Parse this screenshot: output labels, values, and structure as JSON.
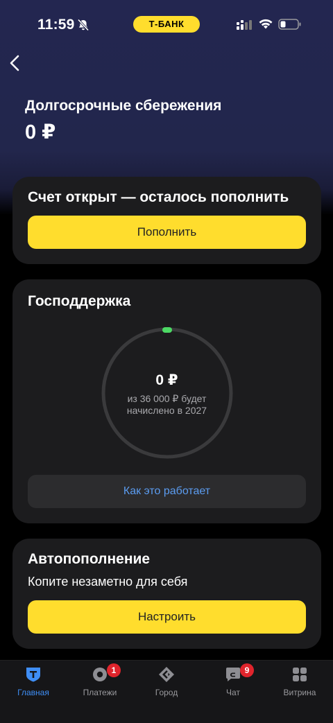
{
  "status_bar": {
    "time": "11:59",
    "bank_label": "Т-БАНК",
    "icons": [
      "bell-off-icon",
      "cellular-signal-icon",
      "wifi-icon",
      "battery-icon"
    ]
  },
  "header": {
    "title": "Долгосрочные сбережения",
    "balance": "0 ₽"
  },
  "top_up_card": {
    "title": "Счет открыт — осталось пополнить",
    "button": "Пополнить"
  },
  "support_card": {
    "title": "Господдержка",
    "amount": "0 ₽",
    "caption_line1": "из 36 000 ₽ будет",
    "caption_line2": "начислено в 2027",
    "progress": 0,
    "button": "Как это работает"
  },
  "auto_card": {
    "title": "Автопополнение",
    "subtitle": "Копите незаметно для себя",
    "button": "Настроить"
  },
  "tabbar": {
    "items": [
      {
        "label": "Главная",
        "icon": "bank-t-icon",
        "active": true
      },
      {
        "label": "Платежи",
        "icon": "payments-icon",
        "badge": "1"
      },
      {
        "label": "Город",
        "icon": "city-icon"
      },
      {
        "label": "Чат",
        "icon": "chat-icon",
        "badge": "9"
      },
      {
        "label": "Витрина",
        "icon": "showcase-icon"
      }
    ]
  },
  "colors": {
    "accent_yellow": "#ffdd2d",
    "link_blue": "#5b9cf0",
    "active_tab": "#3f8ef5",
    "progress_green": "#4cd964",
    "badge_red": "#e0242c"
  }
}
